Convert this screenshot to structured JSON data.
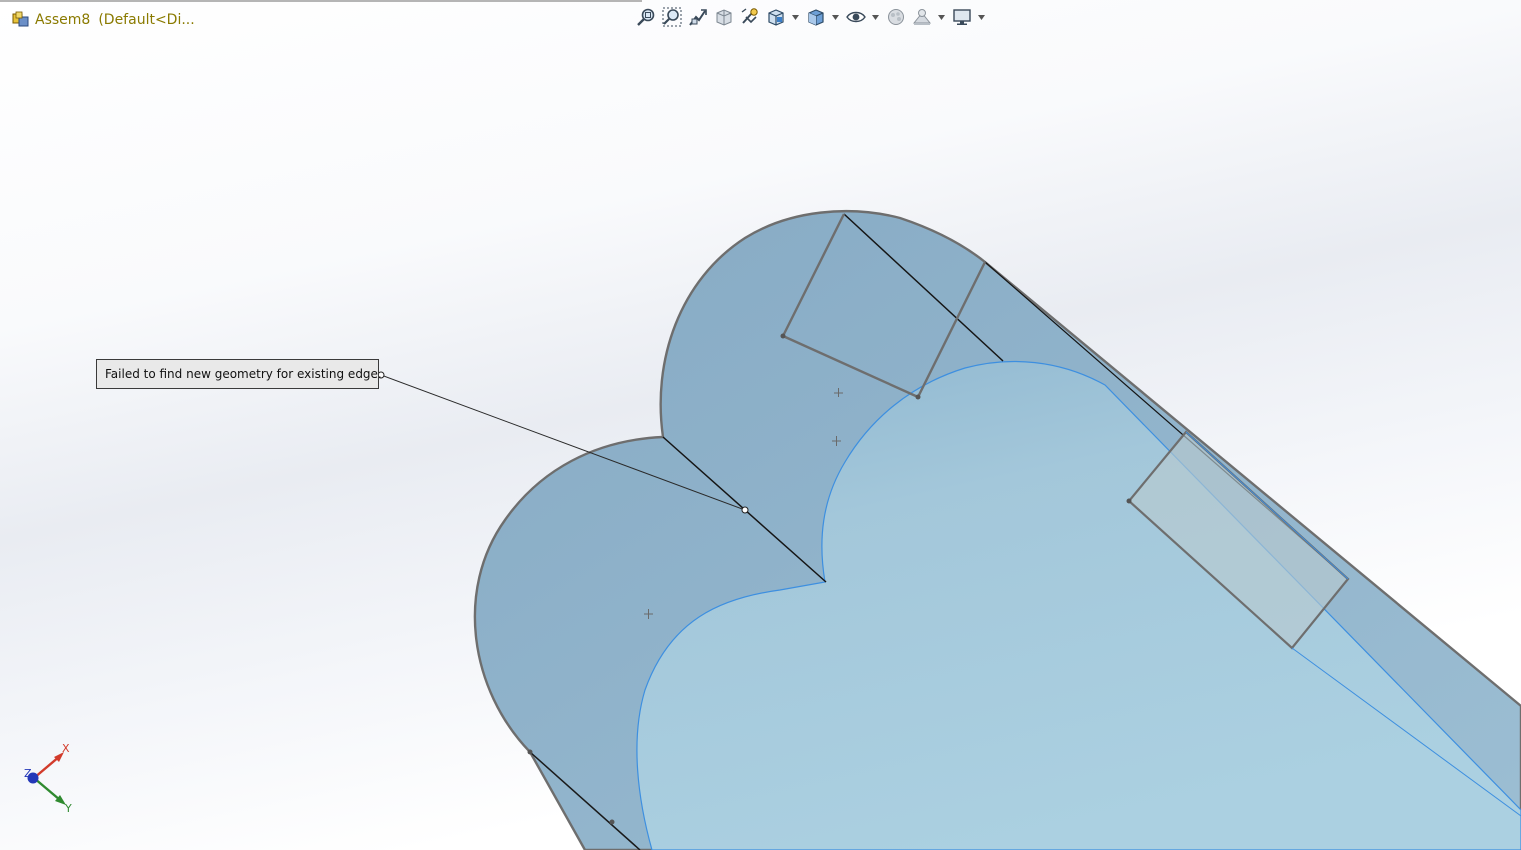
{
  "window": {
    "document_name": "Assem8",
    "configuration": "(Default<Di..."
  },
  "heads_up_toolbar": {
    "buttons": [
      {
        "name": "zoom-to-fit-icon",
        "has_dropdown": false
      },
      {
        "name": "zoom-to-area-icon",
        "has_dropdown": false
      },
      {
        "name": "previous-view-icon",
        "has_dropdown": false
      },
      {
        "name": "section-view-icon",
        "has_dropdown": false
      },
      {
        "name": "dynamic-annotation-views-icon",
        "has_dropdown": false
      },
      {
        "name": "view-orientation-icon",
        "has_dropdown": true
      },
      {
        "name": "display-style-icon",
        "has_dropdown": true
      },
      {
        "name": "hide-show-items-icon",
        "has_dropdown": true
      },
      {
        "name": "edit-appearance-icon",
        "has_dropdown": false
      },
      {
        "name": "apply-scene-icon",
        "has_dropdown": true
      },
      {
        "name": "view-settings-icon",
        "has_dropdown": true
      }
    ]
  },
  "callout": {
    "message": "Failed to find new geometry for existing edge."
  },
  "triad": {
    "x_label": "X",
    "y_label": "Y",
    "z_label": "Z"
  },
  "colors": {
    "part_outer": "#8eb2c9",
    "part_inner": "#a7cadb",
    "selection_edge": "#3d8fe0",
    "edge": "#6d6d6d",
    "title_text": "#8a7a00"
  }
}
